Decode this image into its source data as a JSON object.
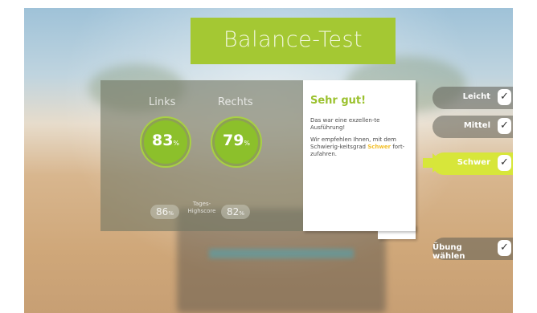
{
  "title": "Balance-Test",
  "stats": {
    "left_label": "Links",
    "right_label": "Rechts",
    "left_score": "83",
    "right_score": "79",
    "score_unit": "%",
    "left_highscore": "86",
    "right_highscore": "82",
    "highscore_unit": "%",
    "highscore_label_line1": "Tages-",
    "highscore_label_line2": "Highscore"
  },
  "message": {
    "heading": "Sehr gut!",
    "line1": "Das war eine exzellen-te Ausführung!",
    "line2_pre": "Wir empfehlen Ihnen, mit dem Schwierig-keitsgrad",
    "line2_hl": "Schwer",
    "line2_post": "fort-zufahren."
  },
  "levels": [
    {
      "label": "Leicht",
      "active": false
    },
    {
      "label": "Mittel",
      "active": false
    },
    {
      "label": "Schwer",
      "active": true
    }
  ],
  "select_exercise_label": "Übung wählen",
  "check_glyph": "✓",
  "colors": {
    "accent_green": "#a4c833",
    "ring_green": "#8cc02b",
    "active_yellow": "#d7e63a",
    "highlight": "#f2bf2a"
  }
}
